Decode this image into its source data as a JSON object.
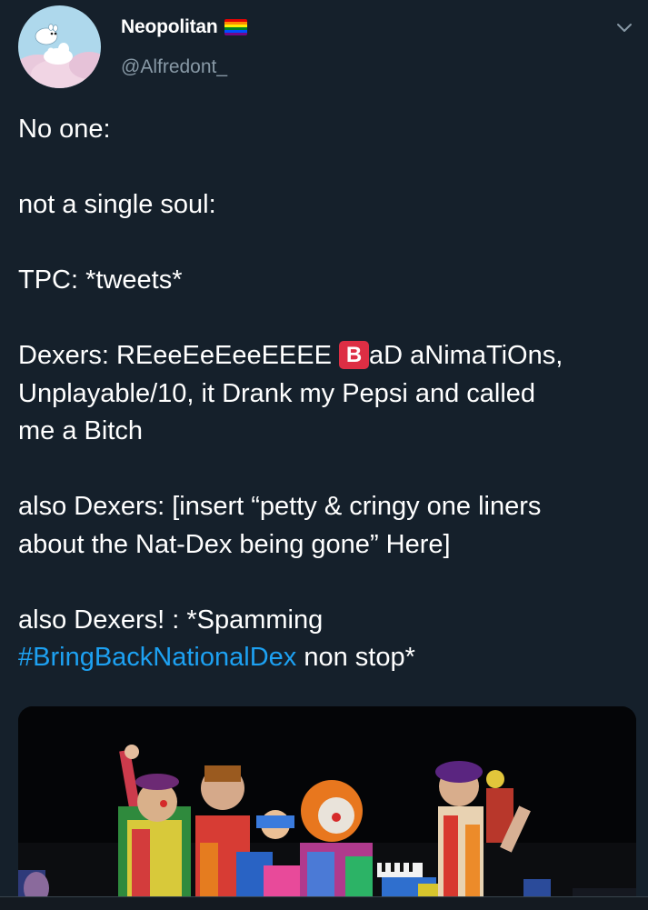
{
  "tweet": {
    "display_name": "Neopolitan",
    "handle": "@Alfredont_",
    "flag_icon": "rainbow-flag-icon",
    "line_1": "No one:",
    "line_2": "not a single soul:",
    "line_3": "TPC: *tweets*",
    "line_4_prefix": "Dexers: REeeEeEeeEEEE ",
    "emoji_b": "B",
    "line_4_suffix": "aD aNimaTiOns,\nUnplayable/10, it Drank my Pepsi and called\nme a Bitch",
    "line_5": "also Dexers: [insert “petty & cringy one liners\nabout the Nat-Dex being gone” Here]",
    "line_6_prefix": "also Dexers! : *Spamming\n",
    "hashtag": "#BringBackNationalDex",
    "line_6_suffix": " non stop*",
    "media_type": "gif-of-clowns"
  },
  "colors": {
    "background": "#15202b",
    "text": "#ffffff",
    "secondary_text": "#8899a6",
    "link": "#1da1f2",
    "emoji_b": "#dd2e44"
  }
}
